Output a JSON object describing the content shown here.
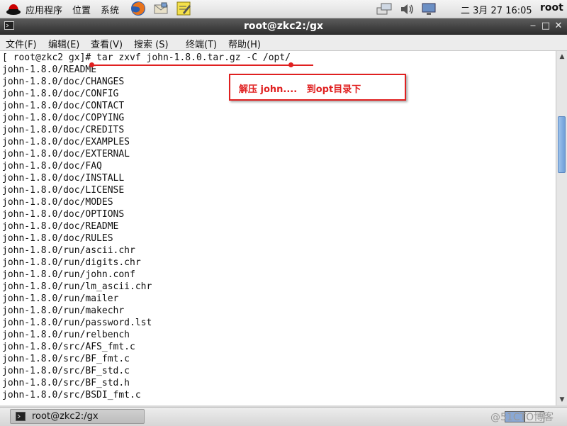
{
  "top_panel": {
    "menus": [
      "应用程序",
      "位置",
      "系统"
    ],
    "clock": "二 3月 27 16:05",
    "user": "root"
  },
  "window": {
    "title": "root@zkc2:/gx"
  },
  "menubar": [
    "文件(F)",
    "编辑(E)",
    "查看(V)",
    "搜索 (S)",
    "终端(T)",
    "帮助(H)"
  ],
  "terminal": {
    "prompt": "[ root@zkc2 gx]# ",
    "command": "tar zxvf john-1.8.0.tar.gz -C /opt/",
    "lines": [
      "john-1.8.0/README",
      "john-1.8.0/doc/CHANGES",
      "john-1.8.0/doc/CONFIG",
      "john-1.8.0/doc/CONTACT",
      "john-1.8.0/doc/COPYING",
      "john-1.8.0/doc/CREDITS",
      "john-1.8.0/doc/EXAMPLES",
      "john-1.8.0/doc/EXTERNAL",
      "john-1.8.0/doc/FAQ",
      "john-1.8.0/doc/INSTALL",
      "john-1.8.0/doc/LICENSE",
      "john-1.8.0/doc/MODES",
      "john-1.8.0/doc/OPTIONS",
      "john-1.8.0/doc/README",
      "john-1.8.0/doc/RULES",
      "john-1.8.0/run/ascii.chr",
      "john-1.8.0/run/digits.chr",
      "john-1.8.0/run/john.conf",
      "john-1.8.0/run/lm_ascii.chr",
      "john-1.8.0/run/mailer",
      "john-1.8.0/run/makechr",
      "john-1.8.0/run/password.lst",
      "john-1.8.0/run/relbench",
      "john-1.8.0/src/AFS_fmt.c",
      "john-1.8.0/src/BF_fmt.c",
      "john-1.8.0/src/BF_std.c",
      "john-1.8.0/src/BF_std.h",
      "john-1.8.0/src/BSDI_fmt.c"
    ]
  },
  "annotation": {
    "text": "解压 john....   到opt目录下",
    "color": "#e02020"
  },
  "taskbar": {
    "task_label": "root@zkc2:/gx",
    "watermark": "@51CTO博客"
  }
}
